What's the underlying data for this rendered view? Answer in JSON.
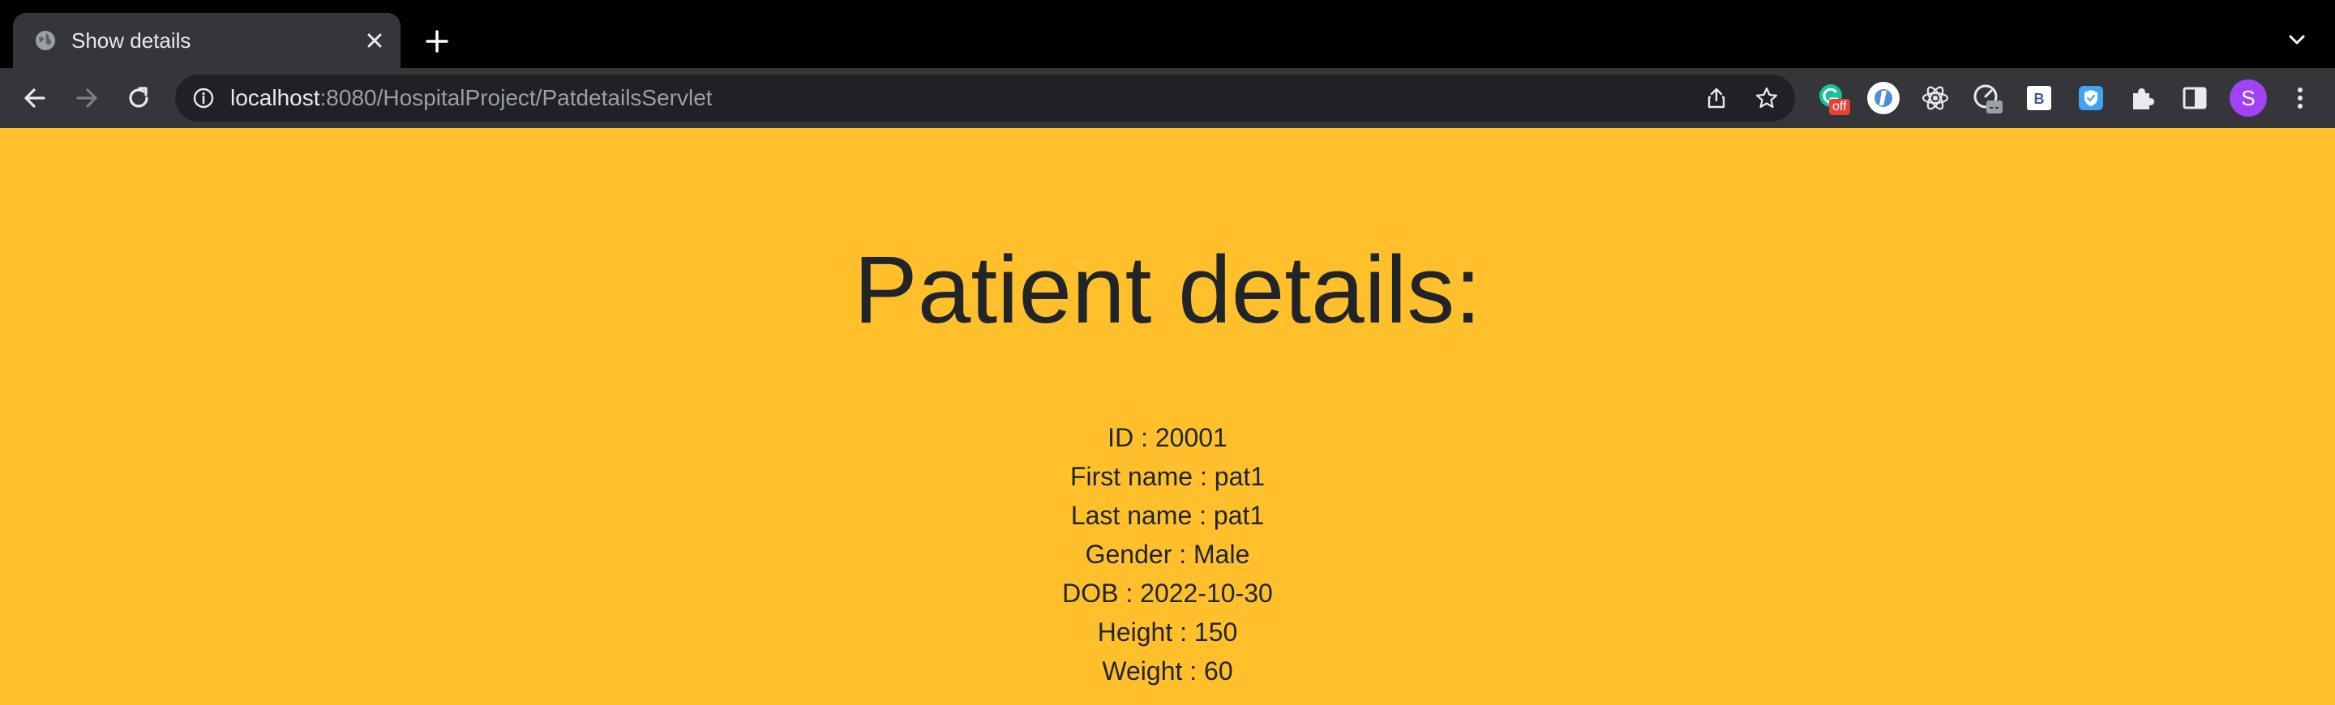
{
  "tab": {
    "title": "Show details"
  },
  "address_bar": {
    "url_host": "localhost",
    "url_rest": ":8080/HospitalProject/PatdetailsServlet"
  },
  "extensions": {
    "grammarly_badge": "off",
    "bootstrap_label": "B"
  },
  "profile": {
    "initial": "S",
    "color": "#a142f4"
  },
  "page": {
    "background": "#ffc02c",
    "title": "Patient details:",
    "details": [
      {
        "label": "ID",
        "value": "20001"
      },
      {
        "label": "First name",
        "value": "pat1"
      },
      {
        "label": "Last name",
        "value": "pat1"
      },
      {
        "label": "Gender",
        "value": "Male"
      },
      {
        "label": "DOB",
        "value": "2022-10-30"
      },
      {
        "label": "Height",
        "value": "150"
      },
      {
        "label": "Weight",
        "value": "60"
      }
    ]
  },
  "icons": {
    "favicon": "globe-icon",
    "close": "close-icon",
    "new_tab": "plus-icon",
    "tab_search": "chevron-down-icon",
    "back": "back-arrow-icon",
    "forward": "forward-arrow-icon",
    "reload": "reload-icon",
    "info": "info-icon",
    "share": "share-icon",
    "bookmark": "star-icon",
    "extensions": "puzzle-icon",
    "side_panel": "side-panel-icon",
    "menu": "three-dots-icon"
  }
}
